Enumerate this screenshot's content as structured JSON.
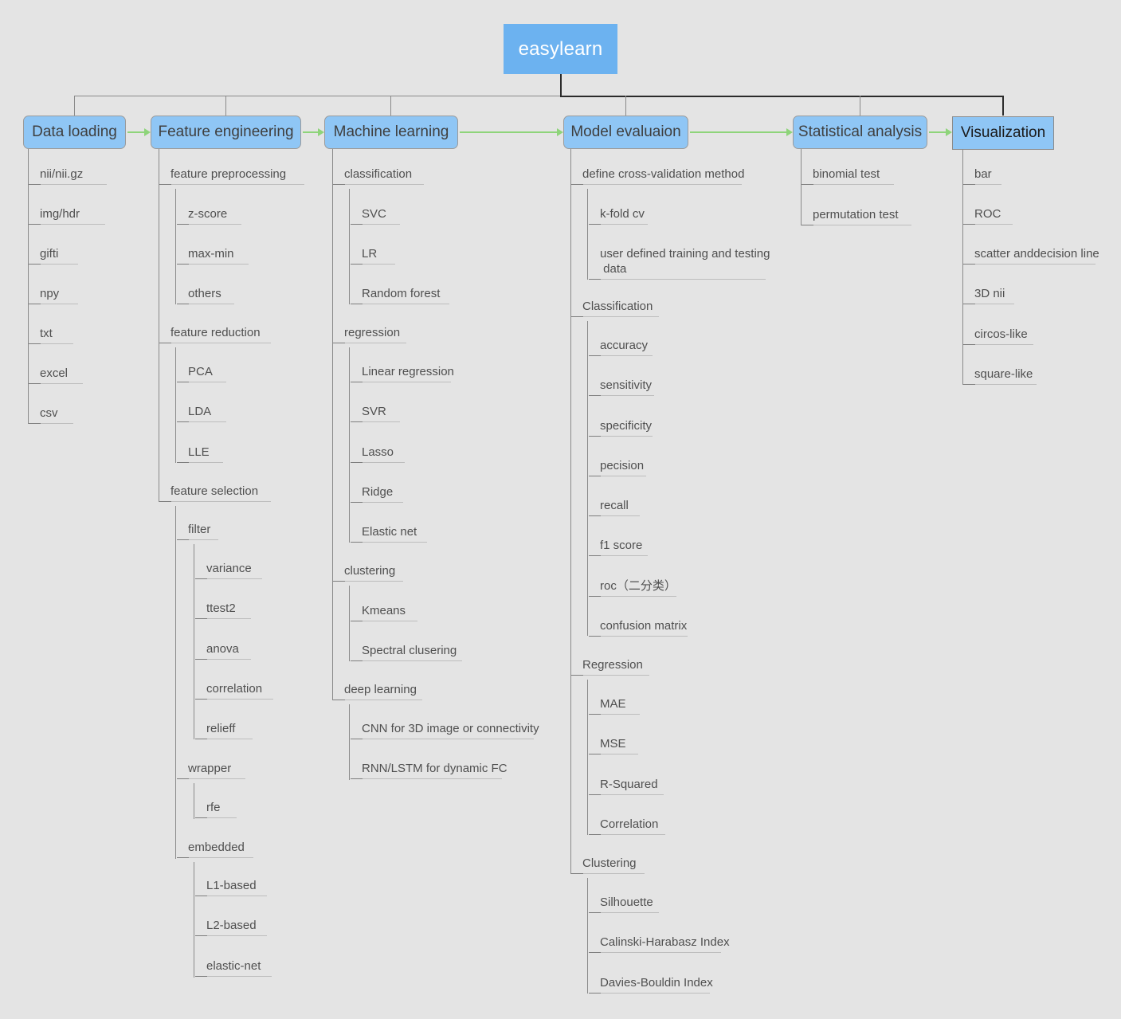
{
  "diagram": {
    "title": "easylearn",
    "root": {
      "label": "easylearn"
    },
    "colors": {
      "background": "#e4e4e4",
      "root_fill": "#6cb2f0",
      "root_text": "#ffffff",
      "node_fill": "#8fc6f5",
      "node_border": "#9b9b9b",
      "node_text": "#3f3f3f",
      "line": "#8a8a8a",
      "underline": "#bdbdbd",
      "arrow": "#8ed47a"
    },
    "top_nodes": [
      {
        "label": "Data loading",
        "style": "rounded"
      },
      {
        "label": "Feature engineering",
        "style": "rounded"
      },
      {
        "label": "Machine learning",
        "style": "rounded"
      },
      {
        "label": "Model evaluaion",
        "style": "rounded"
      },
      {
        "label": "Statistical analysis",
        "style": "rounded"
      },
      {
        "label": "Visualization",
        "style": "squared"
      }
    ],
    "branches": {
      "data_loading": [
        {
          "label": "nii/nii.gz"
        },
        {
          "label": "img/hdr"
        },
        {
          "label": "gifti"
        },
        {
          "label": "npy"
        },
        {
          "label": "txt"
        },
        {
          "label": "excel"
        },
        {
          "label": "csv"
        }
      ],
      "feature_engineering": {
        "feature_preprocessing": {
          "label": "feature preprocessing",
          "children": [
            {
              "label": "z-score"
            },
            {
              "label": "max-min"
            },
            {
              "label": "others"
            }
          ]
        },
        "feature_reduction": {
          "label": "feature reduction",
          "children": [
            {
              "label": "PCA"
            },
            {
              "label": "LDA"
            },
            {
              "label": "LLE"
            }
          ]
        },
        "feature_selection": {
          "label": "feature selection",
          "children": [
            {
              "label": "filter",
              "children": [
                {
                  "label": "variance"
                },
                {
                  "label": "ttest2"
                },
                {
                  "label": "anova"
                },
                {
                  "label": "correlation"
                },
                {
                  "label": "relieff"
                }
              ]
            },
            {
              "label": "wrapper",
              "children": [
                {
                  "label": "rfe"
                }
              ]
            },
            {
              "label": "embedded",
              "children": [
                {
                  "label": "L1-based"
                },
                {
                  "label": "L2-based"
                },
                {
                  "label": "elastic-net"
                }
              ]
            }
          ]
        }
      },
      "machine_learning": {
        "classification": {
          "label": "classification",
          "children": [
            {
              "label": "SVC"
            },
            {
              "label": "LR"
            },
            {
              "label": "Random forest"
            }
          ]
        },
        "regression": {
          "label": "regression",
          "children": [
            {
              "label": "Linear regression"
            },
            {
              "label": "SVR"
            },
            {
              "label": "Lasso"
            },
            {
              "label": "Ridge"
            },
            {
              "label": "Elastic net"
            }
          ]
        },
        "clustering": {
          "label": "clustering",
          "children": [
            {
              "label": "Kmeans"
            },
            {
              "label": "Spectral clusering"
            }
          ]
        },
        "deep_learning": {
          "label": "deep learning",
          "children": [
            {
              "label": "CNN for 3D image or connectivity"
            },
            {
              "label": "RNN/LSTM for dynamic FC"
            }
          ]
        }
      },
      "model_evaluation": {
        "cross_validation": {
          "label": "define cross-validation method",
          "children": [
            {
              "label": "k-fold cv"
            },
            {
              "label": "user defined training and testing\n data"
            }
          ]
        },
        "classification": {
          "label": "Classification",
          "children": [
            {
              "label": "accuracy"
            },
            {
              "label": "sensitivity"
            },
            {
              "label": "specificity"
            },
            {
              "label": "pecision"
            },
            {
              "label": "recall"
            },
            {
              "label": "f1 score"
            },
            {
              "label": "roc（二分类）"
            },
            {
              "label": "confusion matrix"
            }
          ]
        },
        "regression": {
          "label": "Regression",
          "children": [
            {
              "label": "MAE"
            },
            {
              "label": "MSE"
            },
            {
              "label": "R-Squared"
            },
            {
              "label": "Correlation"
            }
          ]
        },
        "clustering": {
          "label": "Clustering",
          "children": [
            {
              "label": "Silhouette"
            },
            {
              "label": "Calinski-Harabasz Index"
            },
            {
              "label": "Davies-Bouldin Index"
            }
          ]
        }
      },
      "statistical_analysis": [
        {
          "label": "binomial test"
        },
        {
          "label": "permutation test"
        }
      ],
      "visualization": [
        {
          "label": "bar"
        },
        {
          "label": "ROC"
        },
        {
          "label": "scatter anddecision line"
        },
        {
          "label": "3D nii"
        },
        {
          "label": "circos-like"
        },
        {
          "label": "square-like"
        }
      ]
    }
  }
}
